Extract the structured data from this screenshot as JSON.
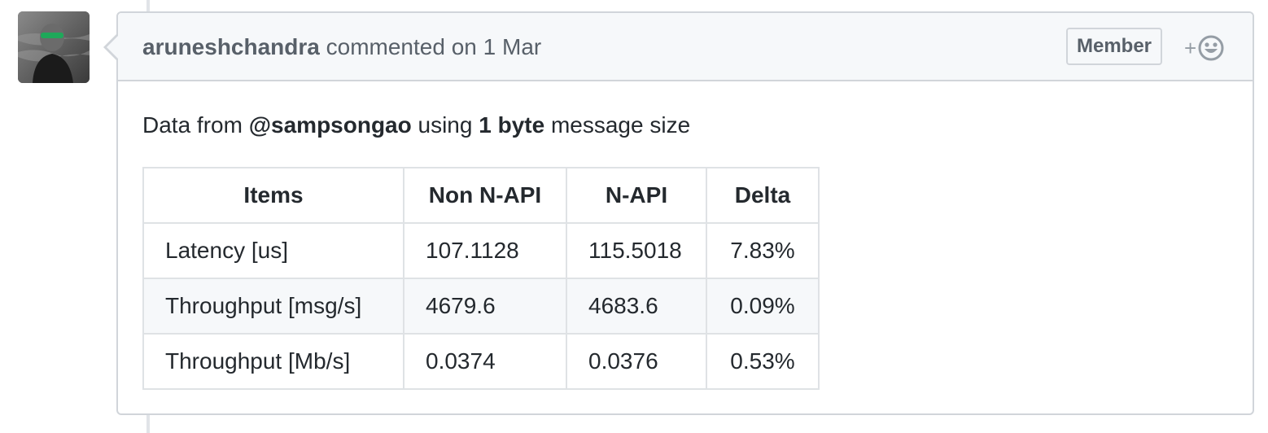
{
  "comment": {
    "author": "aruneshchandra",
    "action": "commented on",
    "date": "1 Mar",
    "badge": "Member",
    "reaction_plus": "+",
    "avatar_icon": "avatar-photo",
    "reaction_icon": "smiley-icon"
  },
  "body": {
    "intro_prefix": "Data from",
    "mention": "@sampsongao",
    "intro_mid": "using",
    "size": "1 byte",
    "intro_suffix": "message size"
  },
  "table": {
    "headers": [
      "Items",
      "Non N-API",
      "N-API",
      "Delta"
    ],
    "rows": [
      [
        "Latency [us]",
        "107.1128",
        "115.5018",
        "7.83%"
      ],
      [
        "Throughput [msg/s]",
        "4679.6",
        "4683.6",
        "0.09%"
      ],
      [
        "Throughput [Mb/s]",
        "0.0374",
        "0.0376",
        "0.53%"
      ]
    ]
  },
  "colors": {
    "border": "#d1d5da",
    "header_bg": "#f6f8fa",
    "muted_text": "#586069",
    "text": "#24292e"
  }
}
